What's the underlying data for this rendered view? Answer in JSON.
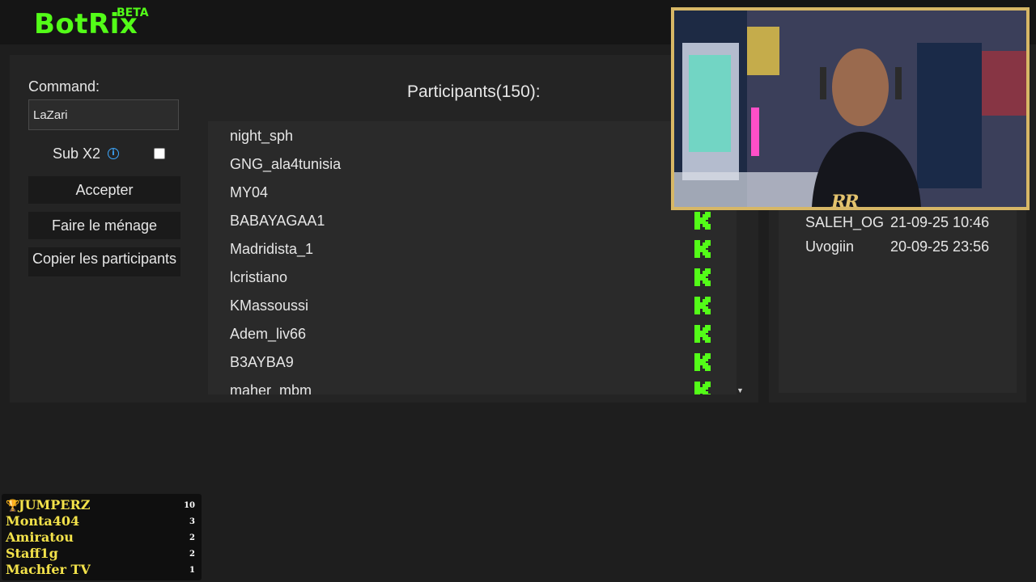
{
  "app": {
    "name": "BotRix",
    "badge": "BETA"
  },
  "command": {
    "label": "Command:",
    "value": "LaZari"
  },
  "sub_option": {
    "label": "Sub X2",
    "info_icon": "info-icon",
    "checked": false
  },
  "buttons": {
    "accept": "Accepter",
    "clean": "Faire le ménage",
    "copy": "Copier les participants"
  },
  "participants": {
    "title": "Participants(150):",
    "items": [
      "night_sph",
      "GNG_ala4tunisia",
      "MY04",
      "BABAYAGAA1",
      "Madridista_1",
      "lcristiano",
      "KMassoussi",
      "Adem_liv66",
      "B3AYBA9",
      "maher_mbm"
    ],
    "platform_icon": "kick-icon",
    "accent_color": "#53fc18"
  },
  "winners": [
    {
      "name": "SALEH_OG",
      "date": "21-09-25 10:46"
    },
    {
      "name": "Uvogiin",
      "date": "20-09-25 23:56"
    }
  ],
  "leaderboard": {
    "icon": "trophy-icon",
    "rows": [
      {
        "name": "JUMPERZ",
        "score": "10"
      },
      {
        "name": "Monta404",
        "score": "3"
      },
      {
        "name": "Amiratou",
        "score": "2"
      },
      {
        "name": "Staff1g",
        "score": "2"
      },
      {
        "name": "Machfer TV",
        "score": "1"
      }
    ]
  },
  "webcam": {
    "logo": "RR"
  }
}
